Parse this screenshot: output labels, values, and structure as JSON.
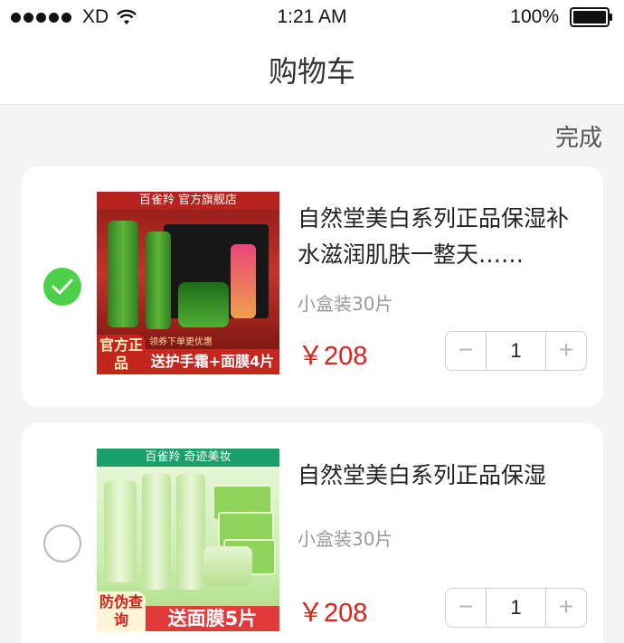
{
  "status_bar": {
    "carrier": "XD",
    "time": "1:21 AM",
    "battery": "100%"
  },
  "nav": {
    "title": "购物车"
  },
  "header": {
    "done_label": "完成"
  },
  "cart_items": [
    {
      "checked": true,
      "title": "自然堂美白系列正品保湿补水滋润肌肤一整天……",
      "variant": "小盒装30片",
      "price": "￥208",
      "quantity": "1",
      "image": {
        "store_banner": "百雀羚 官方旗舰店",
        "badge": "官方正品",
        "promo": "送护手霜+面膜4片",
        "promo_small": "领券下单更优惠"
      }
    },
    {
      "checked": false,
      "title": "自然堂美白系列正品保湿",
      "variant": "小盒装30片",
      "price": "￥208",
      "quantity": "1",
      "image": {
        "store_banner": "百雀羚  奇迹美妆",
        "badge": "防伪查询",
        "promo": "送面膜5片"
      }
    }
  ],
  "stepper": {
    "minus": "−",
    "plus": "+"
  },
  "colors": {
    "accent_price": "#e0201a",
    "check_green": "#4cd04a",
    "background": "#f4f4f4"
  }
}
